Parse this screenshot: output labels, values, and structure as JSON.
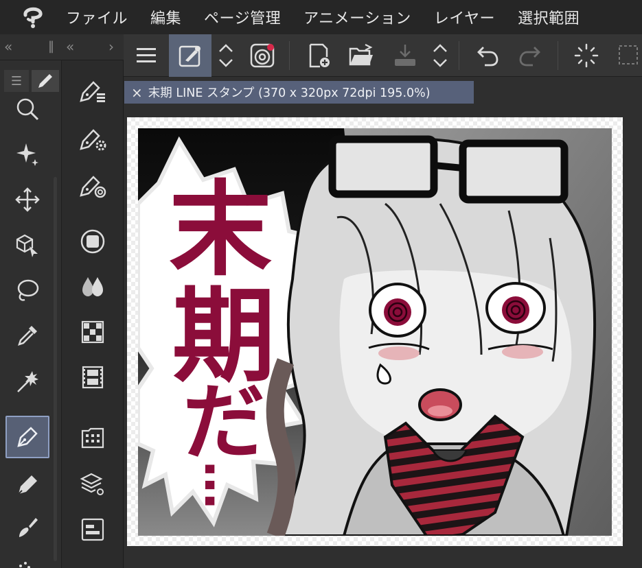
{
  "menu": {
    "items": [
      "ファイル",
      "編集",
      "ページ管理",
      "アニメーション",
      "レイヤー",
      "選択範囲"
    ]
  },
  "panels": {
    "collapse_left": "«",
    "collapse_mid": "«",
    "collapse_right": "›"
  },
  "toolbar": {
    "icons": [
      "menu-icon",
      "edit-brush-icon",
      "up-down-icon",
      "clip-studio-icon",
      "new-file-icon",
      "open-folder-icon",
      "save-icon",
      "up-down-icon",
      "undo-icon",
      "redo-icon",
      "loading-icon",
      "selection-icon"
    ]
  },
  "tool_palette": {
    "tabs": [
      "☰",
      "pen-tab-icon"
    ],
    "tools": [
      "zoom-icon",
      "sparkle-icon",
      "move-icon",
      "object-select-icon",
      "lasso-icon",
      "eyedropper-icon",
      "auto-select-icon",
      "pen-icon",
      "pencil-icon",
      "brush-icon",
      "spray-icon"
    ],
    "selected_tool": "pen-icon"
  },
  "sub_tool_palette": {
    "icons": [
      "subtool-list-icon",
      "subtool-settings-icon",
      "subtool-target-icon",
      "gradient-icon",
      "color-mix-icon",
      "tile-icon",
      "film-icon",
      "grid-icon",
      "layer-stack-icon",
      "panel-icon"
    ]
  },
  "document": {
    "close_glyph": "×",
    "title": "末期 LINE スタンプ (370 x 320px 72dpi 195.0%)"
  },
  "artwork": {
    "text_vertical": [
      "末",
      "期",
      "だ",
      "…"
    ],
    "accent_color": "#8b0d3a",
    "stripe_color": "#a8283c"
  }
}
